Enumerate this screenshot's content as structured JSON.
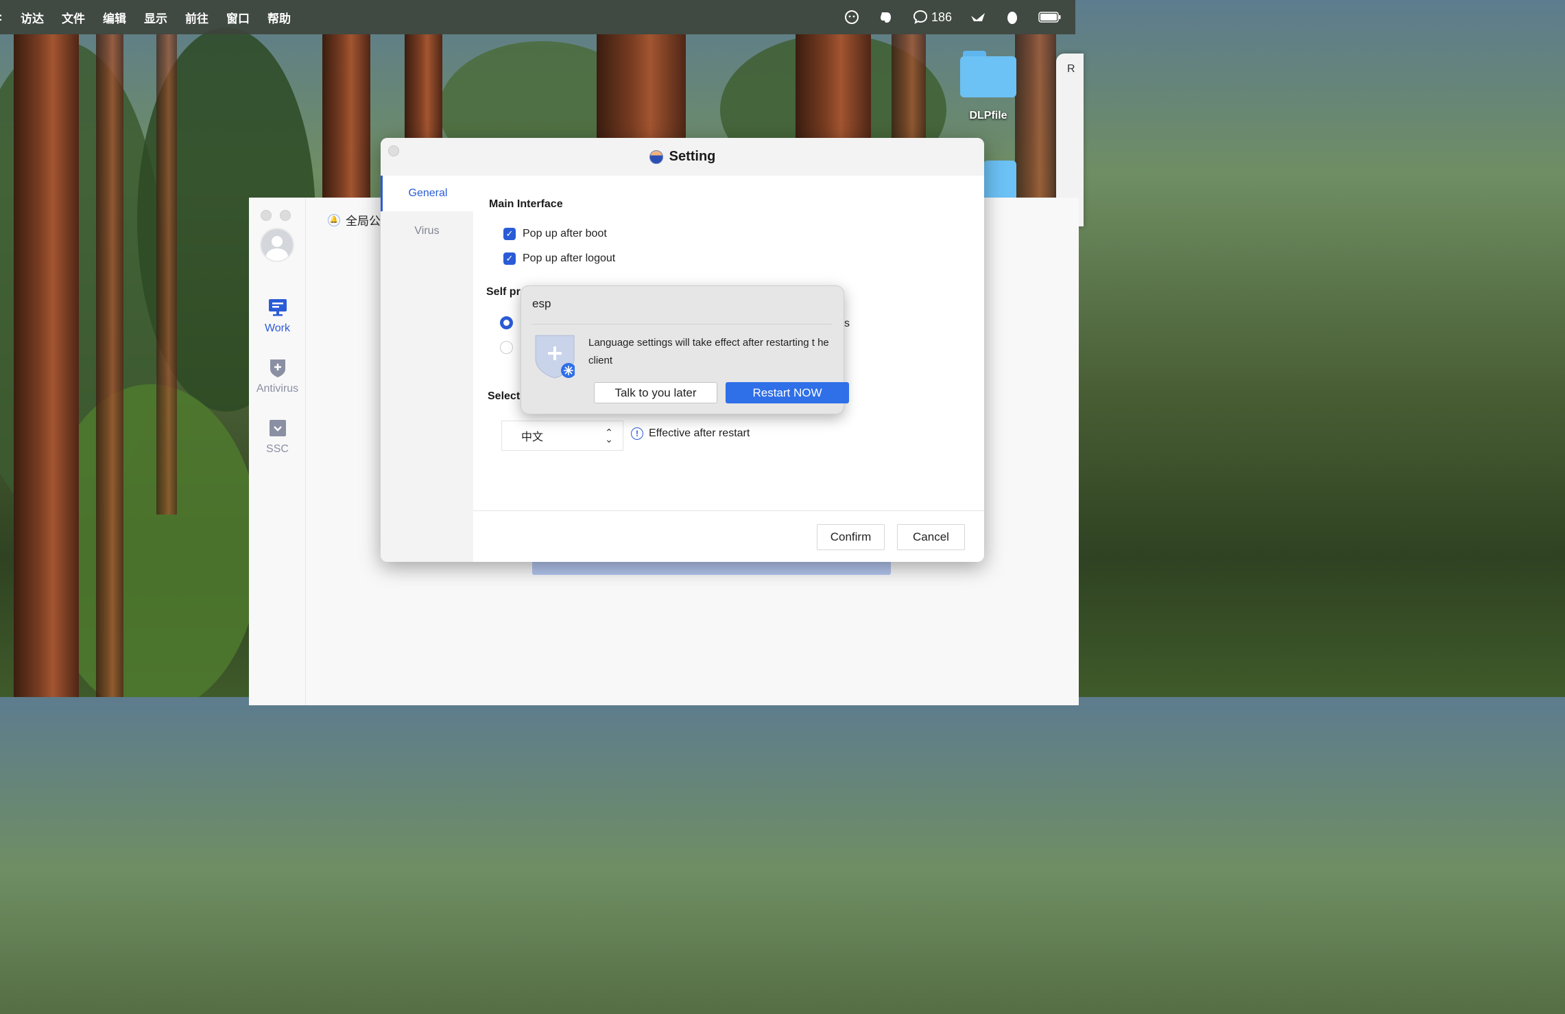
{
  "menubar": {
    "apple": ":",
    "items": [
      "访达",
      "文件",
      "编辑",
      "显示",
      "前往",
      "窗口",
      "帮助"
    ],
    "status": {
      "chat_count": "186"
    }
  },
  "desktop": {
    "folder_label": "DLPfile",
    "right_window_letter": "R"
  },
  "app": {
    "notice_text": "全局公",
    "nav": [
      {
        "label": "Work",
        "icon": "monitor-icon"
      },
      {
        "label": "Antivirus",
        "icon": "shield-plus-icon"
      },
      {
        "label": "SSC",
        "icon": "chevron-box-icon"
      }
    ]
  },
  "setting": {
    "title": "Setting",
    "tabs": [
      "General",
      "Virus"
    ],
    "main_interface": "Main Interface",
    "checkbox1": "Pop up after boot",
    "checkbox2": "Pop up after logout",
    "self_protection": "Self pr",
    "radio_suffix": "s",
    "select_section": "Select",
    "language_value": "中文",
    "hint": "Effective after restart",
    "confirm": "Confirm",
    "cancel": "Cancel"
  },
  "popup": {
    "title": "esp",
    "message": "Language settings will take effect after restarting t he client",
    "later": "Talk to you later",
    "restart": "Restart NOW"
  },
  "colors": {
    "accent": "#2a5bd7",
    "primary_button": "#2f6fe8"
  }
}
